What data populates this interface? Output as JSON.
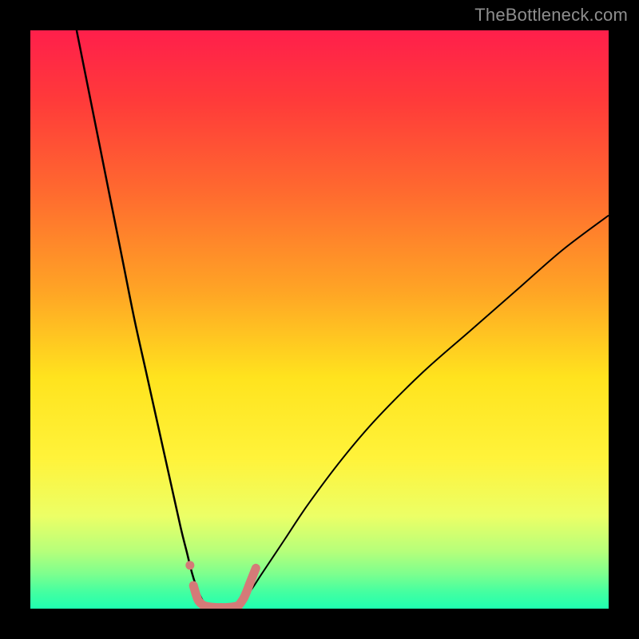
{
  "watermark": {
    "text": "TheBottleneck.com"
  },
  "chart_data": {
    "type": "line",
    "title": "",
    "xlabel": "",
    "ylabel": "",
    "xlim": [
      0,
      100
    ],
    "ylim": [
      0,
      100
    ],
    "grid": false,
    "legend": false,
    "background_gradient": {
      "stops": [
        {
          "pct": 0,
          "color": "#ff1f4b"
        },
        {
          "pct": 12,
          "color": "#ff3a3a"
        },
        {
          "pct": 28,
          "color": "#ff6a2f"
        },
        {
          "pct": 45,
          "color": "#ffa425"
        },
        {
          "pct": 60,
          "color": "#ffe31e"
        },
        {
          "pct": 74,
          "color": "#fff33a"
        },
        {
          "pct": 84,
          "color": "#ecff66"
        },
        {
          "pct": 90,
          "color": "#b7ff7a"
        },
        {
          "pct": 94,
          "color": "#7dff8e"
        },
        {
          "pct": 97,
          "color": "#46ffa0"
        },
        {
          "pct": 100,
          "color": "#1fffb0"
        }
      ]
    },
    "series": [
      {
        "name": "left-branch",
        "stroke": "#000000",
        "stroke_width": 2.5,
        "x": [
          8,
          10,
          12,
          14,
          16,
          18,
          20,
          22,
          24,
          26,
          27,
          28,
          29,
          30
        ],
        "y": [
          100,
          90,
          80,
          70,
          60,
          50,
          41,
          32,
          23,
          14,
          10,
          6,
          3,
          1
        ]
      },
      {
        "name": "right-branch",
        "stroke": "#000000",
        "stroke_width": 2.0,
        "x": [
          36,
          38,
          40,
          44,
          48,
          54,
          60,
          68,
          76,
          84,
          92,
          100
        ],
        "y": [
          1,
          3,
          6,
          12,
          18,
          26,
          33,
          41,
          48,
          55,
          62,
          68
        ]
      },
      {
        "name": "flat-bottom",
        "stroke": "#d47a78",
        "stroke_width": 11,
        "linecap": "round",
        "x": [
          30,
          31,
          32,
          33,
          34,
          35,
          36
        ],
        "y": [
          0.5,
          0.3,
          0.2,
          0.2,
          0.2,
          0.3,
          0.5
        ]
      },
      {
        "name": "bottom-left-thick",
        "stroke": "#d47a78",
        "stroke_width": 11,
        "linecap": "round",
        "x": [
          28.2,
          29,
          30
        ],
        "y": [
          4,
          1.5,
          0.5
        ]
      },
      {
        "name": "bottom-right-thick",
        "stroke": "#d47a78",
        "stroke_width": 11,
        "linecap": "round",
        "x": [
          36,
          37,
          38,
          39
        ],
        "y": [
          0.5,
          2,
          4.5,
          7
        ]
      }
    ],
    "markers": [
      {
        "name": "left-dot",
        "x": 27.6,
        "y": 7.5,
        "r": 5.5,
        "color": "#d47a78"
      }
    ]
  }
}
